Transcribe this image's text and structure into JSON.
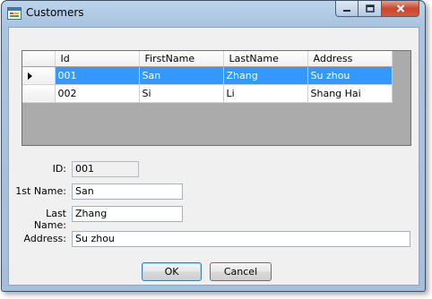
{
  "window": {
    "title": "Customers",
    "icon": "form-icon"
  },
  "grid": {
    "columns": [
      "Id",
      "FirstName",
      "LastName",
      "Address"
    ],
    "rows": [
      {
        "id": "001",
        "first": "San",
        "last": "Zhang",
        "address": "Su zhou",
        "selected": true
      },
      {
        "id": "002",
        "first": "Si",
        "last": "Li",
        "address": "Shang Hai",
        "selected": false
      }
    ]
  },
  "form": {
    "id_label": "ID:",
    "id_value": "001",
    "first_label": "1st Name:",
    "first_value": "San",
    "last_label": "Last Name:",
    "last_value": "Zhang",
    "address_label": "Address:",
    "address_value": "Su zhou"
  },
  "buttons": {
    "ok": "OK",
    "cancel": "Cancel"
  },
  "colors": {
    "selection": "#3399ff",
    "grid_background": "#ababab",
    "close_button": "#c9462c"
  }
}
